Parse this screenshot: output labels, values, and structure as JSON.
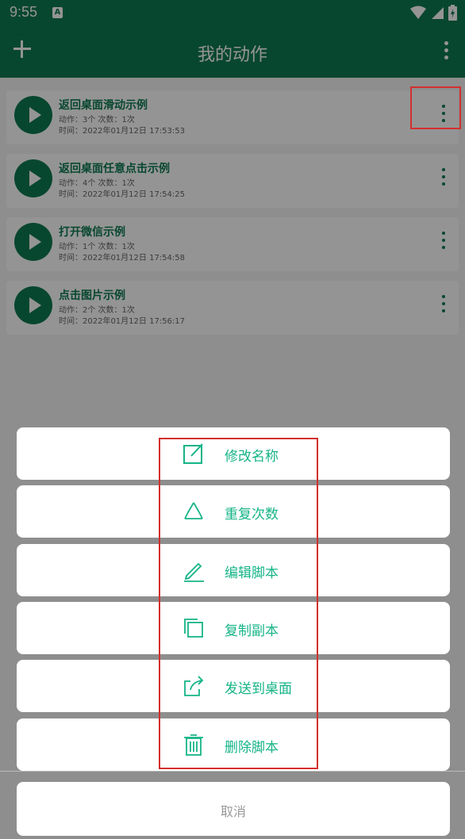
{
  "status": {
    "time": "9:55",
    "badge": "A"
  },
  "appbar": {
    "title": "我的动作"
  },
  "items": [
    {
      "name": "返回桌面滑动示例",
      "meta": "动作：3个 次数：1次",
      "time": "时间：2022年01月12日 17:53:53"
    },
    {
      "name": "返回桌面任意点击示例",
      "meta": "动作：4个 次数：1次",
      "time": "时间：2022年01月12日 17:54:25"
    },
    {
      "name": "打开微信示例",
      "meta": "动作：1个 次数：1次",
      "time": "时间：2022年01月12日 17:54:58"
    },
    {
      "name": "点击图片示例",
      "meta": "动作：2个 次数：1次",
      "time": "时间：2022年01月12日 17:56:17"
    }
  ],
  "sheet": {
    "actions": [
      {
        "label": "修改名称",
        "icon": "edit-icon"
      },
      {
        "label": "重复次数",
        "icon": "recycle-icon"
      },
      {
        "label": "编辑脚本",
        "icon": "pencil-icon"
      },
      {
        "label": "复制副本",
        "icon": "copy-icon"
      },
      {
        "label": "发送到桌面",
        "icon": "share-icon"
      },
      {
        "label": "删除脚本",
        "icon": "trash-icon"
      }
    ],
    "cancel": "取消"
  },
  "colors": {
    "primary": "#0f7a52",
    "accent": "#15b486",
    "highlight": "#d32f2f"
  }
}
